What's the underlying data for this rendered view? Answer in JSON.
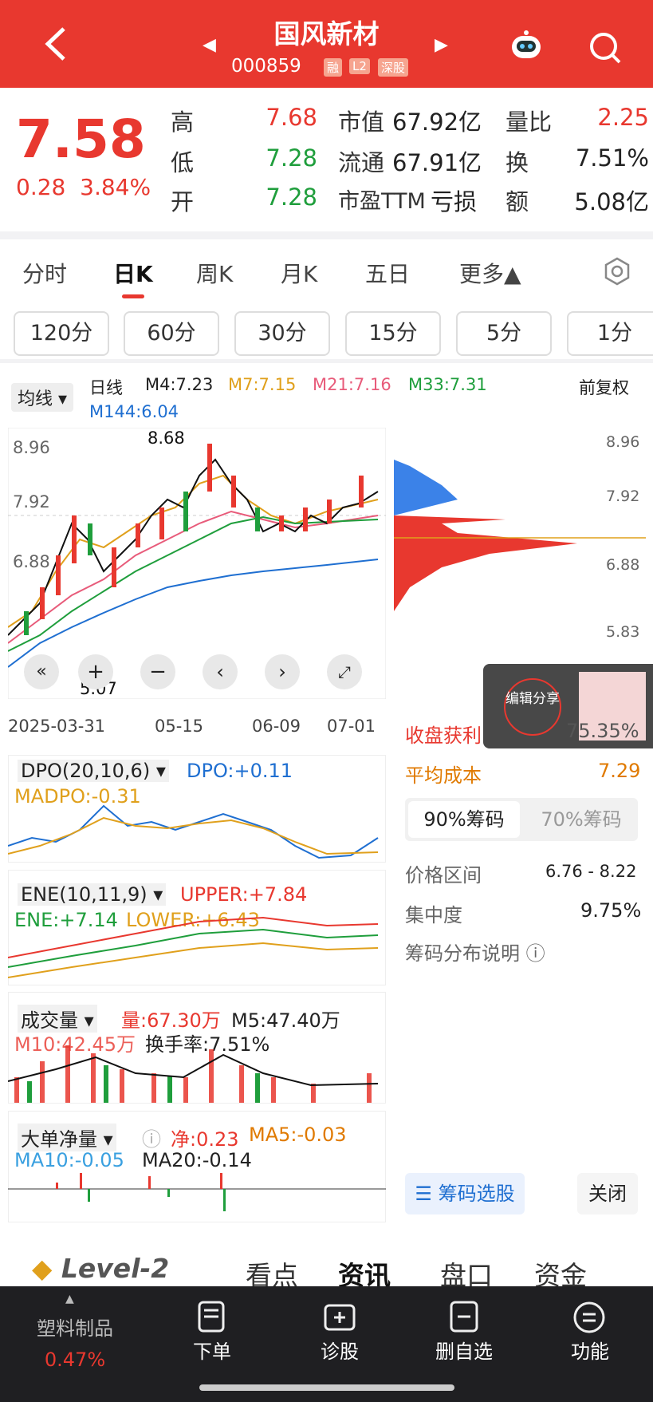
{
  "header": {
    "title": "国风新材",
    "code": "000859",
    "tags": [
      "融",
      "L2",
      "深股"
    ]
  },
  "quote": {
    "price": "7.58",
    "change": "0.28",
    "change_pct": "3.84%",
    "high_label": "高",
    "high": "7.68",
    "low_label": "低",
    "low": "7.28",
    "open_label": "开",
    "open": "7.28",
    "mcap_label": "市值",
    "mcap": "67.92亿",
    "float_label": "流通",
    "float": "67.91亿",
    "pe_label": "市盈TTM",
    "pe": "亏损",
    "vr_label": "量比",
    "vr": "2.25",
    "turn_label": "换",
    "turn": "7.51%",
    "amt_label": "额",
    "amt": "5.08亿"
  },
  "tabs": [
    "分时",
    "日K",
    "周K",
    "月K",
    "五日",
    "更多▲"
  ],
  "periods": [
    "120分",
    "60分",
    "30分",
    "15分",
    "5分",
    "1分"
  ],
  "ma": {
    "selector": "均线",
    "daily": "日线",
    "m4": "M4:7.23",
    "m7": "M7:7.15",
    "m21": "M21:7.16",
    "m33": "M33:7.31",
    "m144": "M144:6.04",
    "adjust": "前复权"
  },
  "kchart": {
    "high_mark": "8.68",
    "low_mark": "5.07",
    "y_labels": [
      "8.96",
      "7.92",
      "6.88"
    ],
    "dates": [
      "2025-03-31",
      "05-15",
      "06-09",
      "07-01"
    ]
  },
  "chips": {
    "y_labels": [
      "8.96",
      "7.92",
      "6.88",
      "5.83"
    ],
    "profit_label": "收盘获利",
    "profit_value": "75.35%",
    "avg_label": "平均成本",
    "avg_value": "7.29",
    "tab90": "90%筹码",
    "tab70": "70%筹码",
    "range_label": "价格区间",
    "range_value": "6.76 - 8.22",
    "conc_label": "集中度",
    "conc_value": "9.75%",
    "desc": "筹码分布说明",
    "pick": "筹码选股",
    "close": "关闭",
    "share": "编辑分享"
  },
  "dpo": {
    "name": "DPO(20,10,6)",
    "dpo": "DPO:+0.11",
    "madpo": "MADPO:-0.31"
  },
  "ene": {
    "name": "ENE(10,11,9)",
    "upper": "UPPER:+7.84",
    "ene": "ENE:+7.14",
    "lower": "LOWER:+6.43"
  },
  "vol": {
    "name": "成交量",
    "vol": "量:67.30万",
    "m5": "M5:47.40万",
    "m10": "M10:42.45万",
    "turn": "换手率:7.51%"
  },
  "big": {
    "name": "大单净量",
    "net": "净:0.23",
    "ma5": "MA5:-0.03",
    "ma10": "MA10:-0.05",
    "ma20": "MA20:-0.14"
  },
  "subtabs": [
    "Level-2",
    "看点",
    "资讯",
    "盘口",
    "资金"
  ],
  "bottom": {
    "sector": "塑料制品",
    "sector_pct": "0.47%",
    "items": [
      "下单",
      "诊股",
      "删自选",
      "功能"
    ]
  },
  "colors": {
    "red": "#e8382f",
    "green": "#1f9e3c",
    "blue": "#1f6fd1"
  }
}
